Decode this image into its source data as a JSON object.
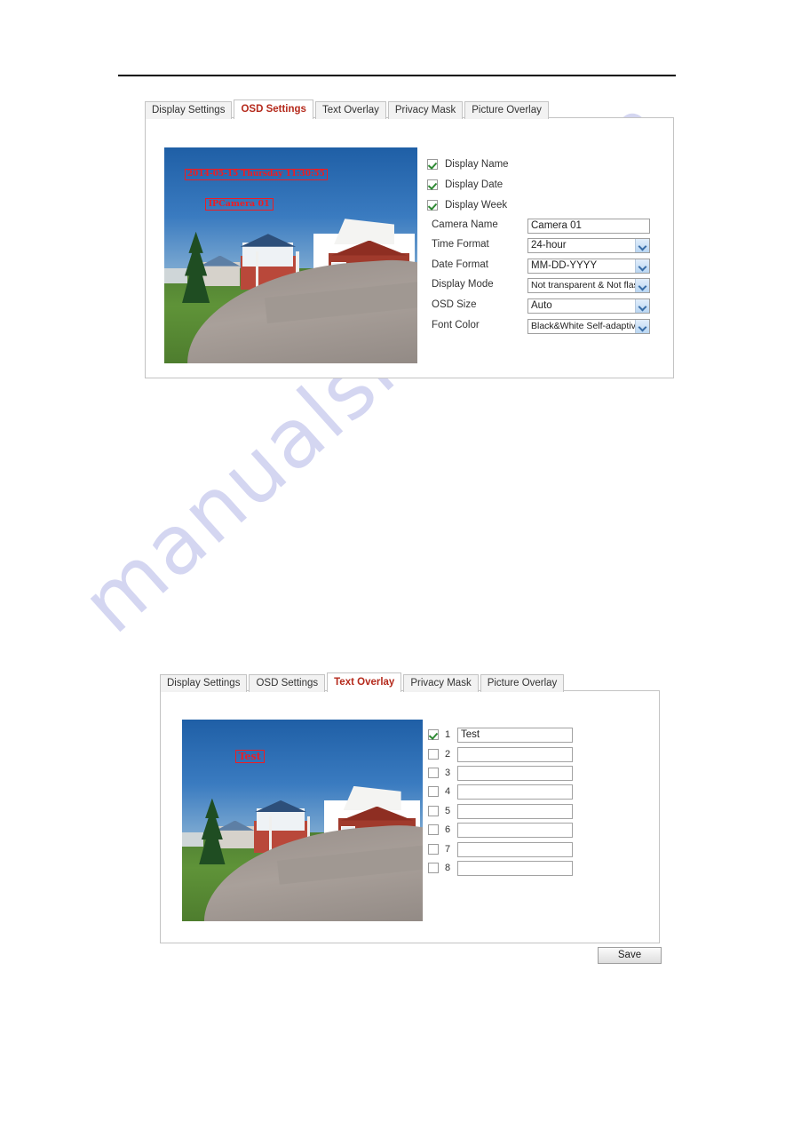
{
  "watermark": {
    "text": "manualshive.com"
  },
  "panels": [
    {
      "id": "osd-settings-panel",
      "tabs": [
        {
          "label": "Display Settings",
          "active": false
        },
        {
          "label": "OSD Settings",
          "active": true
        },
        {
          "label": "Text Overlay",
          "active": false
        },
        {
          "label": "Privacy Mask",
          "active": false
        },
        {
          "label": "Picture Overlay",
          "active": false
        }
      ],
      "preview": {
        "osd_date_text": "2014-05-15 Thursday 11:30:55",
        "osd_name_text": "IPCamera 01"
      },
      "checkboxes": [
        {
          "label": "Display Name",
          "checked": true
        },
        {
          "label": "Display Date",
          "checked": true
        },
        {
          "label": "Display Week",
          "checked": true
        }
      ],
      "fields": [
        {
          "label": "Camera Name",
          "value": "Camera 01",
          "type": "text"
        },
        {
          "label": "Time Format",
          "value": "24-hour",
          "type": "select"
        },
        {
          "label": "Date Format",
          "value": "MM-DD-YYYY",
          "type": "select"
        },
        {
          "label": "Display Mode",
          "value": "Not transparent & Not flash",
          "type": "select"
        },
        {
          "label": "OSD Size",
          "value": "Auto",
          "type": "select"
        },
        {
          "label": "Font Color",
          "value": "Black&White Self-adaptive",
          "type": "select"
        }
      ]
    },
    {
      "id": "text-overlay-panel",
      "tabs": [
        {
          "label": "Display Settings",
          "active": false
        },
        {
          "label": "OSD Settings",
          "active": false
        },
        {
          "label": "Text Overlay",
          "active": true
        },
        {
          "label": "Privacy Mask",
          "active": false
        },
        {
          "label": "Picture Overlay",
          "active": false
        }
      ],
      "preview": {
        "osd_overlay_text": "Test"
      },
      "rows": [
        {
          "num": "1",
          "checked": true,
          "value": "Test"
        },
        {
          "num": "2",
          "checked": false,
          "value": ""
        },
        {
          "num": "3",
          "checked": false,
          "value": ""
        },
        {
          "num": "4",
          "checked": false,
          "value": ""
        },
        {
          "num": "5",
          "checked": false,
          "value": ""
        },
        {
          "num": "6",
          "checked": false,
          "value": ""
        },
        {
          "num": "7",
          "checked": false,
          "value": ""
        },
        {
          "num": "8",
          "checked": false,
          "value": ""
        }
      ],
      "save_label": "Save"
    }
  ],
  "colors": {
    "active_tab_text": "#b52a1c",
    "osd_overlay": "#ee1c22",
    "checkmark": "#2f8a34",
    "watermark": "#c9cbee"
  }
}
